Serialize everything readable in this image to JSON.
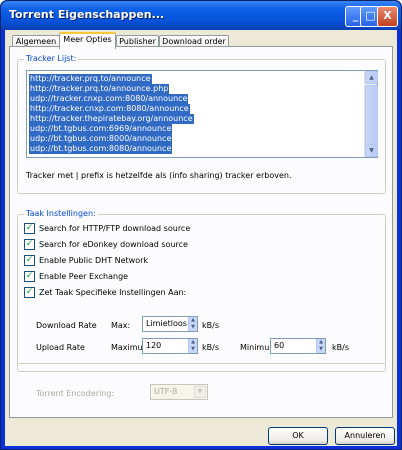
{
  "window": {
    "title": "Torrent Eigenschappen...",
    "buttons": [
      "_",
      "□",
      "X"
    ]
  },
  "tabs": [
    "Algemeen",
    "Meer Opties",
    "Publisher",
    "Download order"
  ],
  "tracker_group": {
    "title": "Tracker Lijst:",
    "trackers": [
      "http://tracker.prq.to/announce",
      "http://tracker.prq.to/announce.php",
      "udp://tracker.cnxp.com:8080/announce",
      "http://tracker.cnxp.com:8080/announce",
      "http://tracker.thepiratebay.org/announce",
      "udp://bt.tgbus.com:6969/announce",
      "udp://bt.tgbus.com:8000/announce",
      "udp://bt.tgbus.com:8080/announce"
    ],
    "note": "Tracker met | prefix is hetzelfde als (info sharing) tracker erboven."
  },
  "task_group": {
    "title": "Taak Instellingen:",
    "options": [
      "Search for HTTP/FTP download source",
      "Search for eDonkey download source",
      "Enable Public DHT Network",
      "Enable Peer Exchange",
      "Zet Taak Specifieke Instellingen Aan:"
    ],
    "check_mark": "✓",
    "download_rate_label": "Download Rate",
    "download_max_label": "Max:",
    "download_max_value": "Limietloos",
    "upload_rate_label": "Upload Rate",
    "upload_max_label": "Maximu",
    "upload_max_value": "120",
    "upload_min_label": "Minimun",
    "upload_min_value": "60",
    "unit": "kB/s",
    "encoding_label": "Torrent Encodering:",
    "encoding_value": "UTF-8"
  },
  "footer": {
    "ok_label": "OK",
    "cancel_label": "Annuleren"
  },
  "colors": {
    "accent": "#0046d5",
    "selection": "#316ac5",
    "titlebar": "#0a5fe6"
  }
}
